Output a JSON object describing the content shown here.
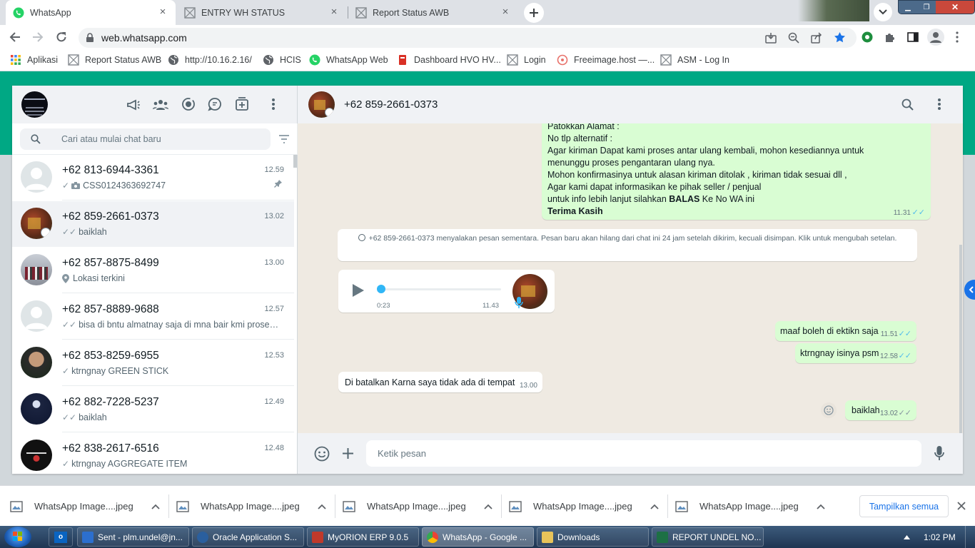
{
  "browser": {
    "tabs": [
      {
        "title": "WhatsApp",
        "active": true
      },
      {
        "title": "ENTRY WH STATUS",
        "active": false
      },
      {
        "title": "Report Status AWB",
        "active": false
      }
    ],
    "url": "web.whatsapp.com",
    "bookmarks": [
      "Aplikasi",
      "Report Status AWB",
      "http://10.16.2.16/",
      "HCIS",
      "WhatsApp Web",
      "Dashboard HVO HV...",
      "Login",
      "Freeimage.host —...",
      "ASM - Log In"
    ]
  },
  "left": {
    "search_placeholder": "Cari atau mulai chat baru",
    "chats": [
      {
        "name": "+62 813-6944-3361",
        "time": "12.59",
        "tick": "✓",
        "preview": "CSS0124363692747",
        "icon": "camera",
        "pinned": true
      },
      {
        "name": "+62 859-2661-0373",
        "time": "13.02",
        "tick": "✓✓",
        "preview": "baiklah",
        "selected": true
      },
      {
        "name": "+62 857-8875-8499",
        "time": "13.00",
        "tick": "",
        "preview": "Lokasi terkini",
        "icon": "location"
      },
      {
        "name": "+62 857-8889-9688",
        "time": "12.57",
        "tick": "✓✓",
        "preview": "bisa di bntu almatnay saja di mna bair kmi proses..."
      },
      {
        "name": "+62 853-8259-6955",
        "time": "12.53",
        "tick": "✓",
        "preview": "ktrngnay GREEN STICK"
      },
      {
        "name": "+62 882-7228-5237",
        "time": "12.49",
        "tick": "✓✓",
        "preview": "baiklah"
      },
      {
        "name": "+62 838-2617-6516",
        "time": "12.48",
        "tick": "✓",
        "preview": "ktrngnay AGGREGATE ITEM"
      }
    ]
  },
  "conversation": {
    "contact": "+62 859-2661-0373",
    "long_message": {
      "lines": [
        "Patokkan Alamat :",
        "No tlp alternatif :",
        "Agar kiriman Dapat kami proses antar ulang kembali, mohon kesediannya untuk",
        "menunggu proses pengantaran ulang nya.",
        "Mohon konfirmasinya untuk alasan kiriman ditolak , kiriman tidak sesuai dll ,",
        "Agar kami dapat informasikan ke pihak seller / penjual"
      ],
      "info_prefix": "untuk info lebih lanjut silahkan ",
      "info_bold": "BALAS",
      "info_suffix": " Ke No WA ini",
      "closing": "Terima Kasih",
      "time": "11.31",
      "tick": "✓✓"
    },
    "system_notice": "+62 859-2661-0373 menyalakan pesan sementara. Pesan baru akan hilang dari chat ini 24 jam setelah dikirim, kecuali disimpan. Klik untuk mengubah setelan.",
    "voice": {
      "duration": "0:23",
      "time": "11.43",
      "progress": 0.0
    },
    "messages": [
      {
        "dir": "out",
        "text": "maaf boleh di ektikn saja",
        "time": "11.51",
        "tick": "✓✓"
      },
      {
        "dir": "out",
        "text": "ktrngnay isinya psm",
        "time": "12.58",
        "tick": "✓✓"
      },
      {
        "dir": "in",
        "text": "Di batalkan Karna saya tidak ada di tempat",
        "time": "13.00"
      },
      {
        "dir": "out",
        "text": "baiklah",
        "time": "13.02",
        "tick": "✓✓"
      }
    ],
    "composer_placeholder": "Ketik pesan"
  },
  "downloads": {
    "files": [
      "WhatsApp Image....jpeg",
      "WhatsApp Image....jpeg",
      "WhatsApp Image....jpeg",
      "WhatsApp Image....jpeg",
      "WhatsApp Image....jpeg"
    ],
    "show_all": "Tampilkan semua"
  },
  "taskbar": {
    "items": [
      "Sent - plm.undel@jn...",
      "Oracle Application S...",
      "MyORION ERP 9.0.5",
      "WhatsApp - Google ...",
      "Downloads",
      "REPORT UNDEL NO..."
    ],
    "clock": "1:02 PM"
  },
  "colors": {
    "wa_green": "#00a884",
    "out_bubble": "#d9fdd3",
    "chat_bg": "#efeae2",
    "read_tick": "#53bdeb"
  }
}
